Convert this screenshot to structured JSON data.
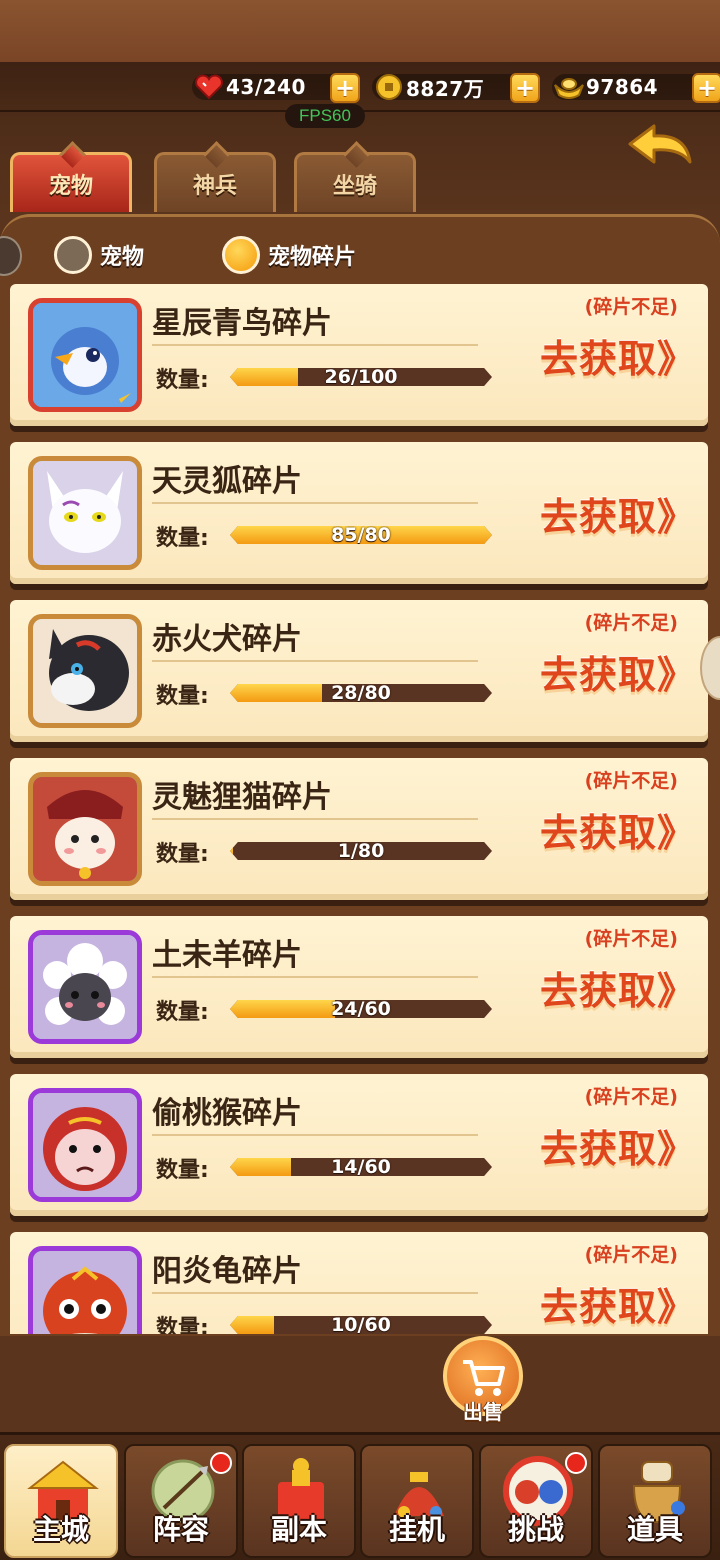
{
  "resources": {
    "stamina": "43/240",
    "coins": "8827万",
    "gold": "97864",
    "fps": "FPS60"
  },
  "tabs": [
    {
      "label": "宠物",
      "active": true
    },
    {
      "label": "神兵",
      "active": false
    },
    {
      "label": "坐骑",
      "active": false
    }
  ],
  "filters": [
    {
      "label": "宠物",
      "selected": false
    },
    {
      "label": "宠物碎片",
      "selected": true
    }
  ],
  "quantity_label": "数量:",
  "items": [
    {
      "name": "星辰青鸟碎片",
      "count": "26/100",
      "progress": 0.26,
      "warning": "(碎片不足)",
      "action": "去获取》",
      "frame": "red"
    },
    {
      "name": "天灵狐碎片",
      "count": "85/80",
      "progress": 1.0,
      "warning": "",
      "action": "去获取》",
      "frame": "orange"
    },
    {
      "name": "赤火犬碎片",
      "count": "28/80",
      "progress": 0.35,
      "warning": "(碎片不足)",
      "action": "去获取》",
      "frame": "orange"
    },
    {
      "name": "灵魅狸猫碎片",
      "count": "1/80",
      "progress": 0.0125,
      "warning": "(碎片不足)",
      "action": "去获取》",
      "frame": "orange"
    },
    {
      "name": "土未羊碎片",
      "count": "24/60",
      "progress": 0.4,
      "warning": "(碎片不足)",
      "action": "去获取》",
      "frame": "purple"
    },
    {
      "name": "偷桃猴碎片",
      "count": "14/60",
      "progress": 0.233,
      "warning": "(碎片不足)",
      "action": "去获取》",
      "frame": "purple"
    },
    {
      "name": "阳炎龟碎片",
      "count": "10/60",
      "progress": 0.167,
      "warning": "(碎片不足)",
      "action": "去获取》",
      "frame": "purple"
    }
  ],
  "sell_label": "出售",
  "nav": [
    {
      "label": "主城",
      "active": true,
      "dot": false,
      "icon": "castle-icon"
    },
    {
      "label": "阵容",
      "active": false,
      "dot": true,
      "icon": "formation-icon"
    },
    {
      "label": "副本",
      "active": false,
      "dot": false,
      "icon": "dungeon-icon"
    },
    {
      "label": "挂机",
      "active": false,
      "dot": false,
      "icon": "idle-icon"
    },
    {
      "label": "挑战",
      "active": false,
      "dot": true,
      "icon": "challenge-icon"
    },
    {
      "label": "道具",
      "active": false,
      "dot": false,
      "icon": "bag-icon"
    }
  ]
}
